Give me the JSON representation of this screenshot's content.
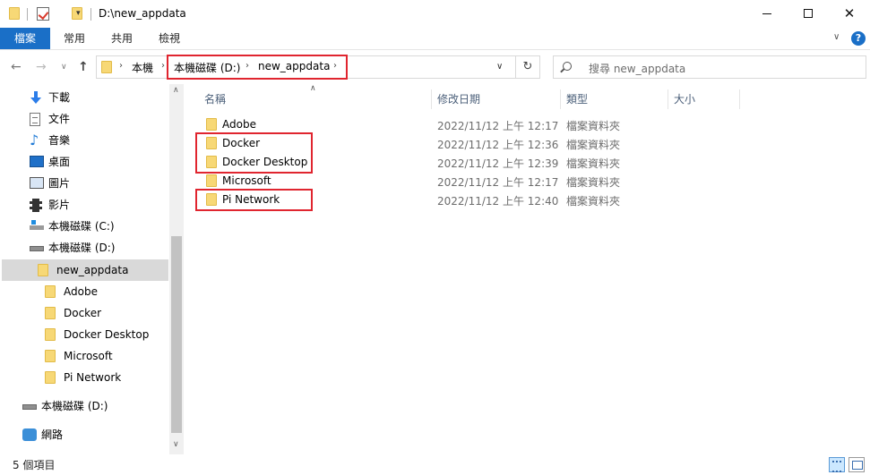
{
  "window": {
    "title": "D:\\new_appdata",
    "minimize_icon": "minimize-icon",
    "maximize_icon": "maximize-icon",
    "close_glyph": "✕"
  },
  "quick_access": {
    "dropdown_glyph": "▾"
  },
  "ribbon": {
    "tabs": [
      "檔案",
      "常用",
      "共用",
      "檢視"
    ],
    "expand_glyph": "∨",
    "help_glyph": "?"
  },
  "nav": {
    "back_glyph": "←",
    "forward_glyph": "→",
    "recent_glyph": "∨",
    "up_glyph": "↑",
    "refresh_glyph": "↻",
    "address": {
      "root": "本機",
      "drive": "本機磁碟 (D:)",
      "folder": "new_appdata",
      "chevron": "›",
      "dropdown_glyph": "∨"
    },
    "search_placeholder": "搜尋 new_appdata"
  },
  "sidebar": {
    "items": [
      {
        "label": "下載",
        "icon": "download-icon"
      },
      {
        "label": "文件",
        "icon": "document-icon"
      },
      {
        "label": "音樂",
        "icon": "music-icon"
      },
      {
        "label": "桌面",
        "icon": "desktop-icon"
      },
      {
        "label": "圖片",
        "icon": "pictures-icon"
      },
      {
        "label": "影片",
        "icon": "videos-icon"
      },
      {
        "label": "本機磁碟 (C:)",
        "icon": "drive-c-icon"
      },
      {
        "label": "本機磁碟 (D:)",
        "icon": "drive-icon"
      },
      {
        "label": "new_appdata",
        "icon": "folder-icon"
      },
      {
        "label": "Adobe",
        "icon": "folder-icon"
      },
      {
        "label": "Docker",
        "icon": "folder-icon"
      },
      {
        "label": "Docker Desktop",
        "icon": "folder-icon"
      },
      {
        "label": "Microsoft",
        "icon": "folder-icon"
      },
      {
        "label": "Pi Network",
        "icon": "folder-icon"
      },
      {
        "label": "本機磁碟 (D:)",
        "icon": "drive-icon"
      },
      {
        "label": "網路",
        "icon": "network-icon"
      }
    ],
    "selected": "new_appdata",
    "scroll_up_glyph": "∧",
    "scroll_down_glyph": "∨"
  },
  "filelist": {
    "sort_glyph": "∧",
    "columns": [
      "名稱",
      "修改日期",
      "類型",
      "大小"
    ],
    "rows": [
      {
        "name": "Adobe",
        "date": "2022/11/12 上午 12:17",
        "type": "檔案資料夾"
      },
      {
        "name": "Docker",
        "date": "2022/11/12 上午 12:36",
        "type": "檔案資料夾"
      },
      {
        "name": "Docker Desktop",
        "date": "2022/11/12 上午 12:39",
        "type": "檔案資料夾"
      },
      {
        "name": "Microsoft",
        "date": "2022/11/12 上午 12:17",
        "type": "檔案資料夾"
      },
      {
        "name": "Pi Network",
        "date": "2022/11/12 上午 12:40",
        "type": "檔案資料夾"
      }
    ]
  },
  "status": {
    "item_count": "5 個項目"
  },
  "colors": {
    "accent": "#1a6fc7",
    "highlight_box": "#e0252f",
    "folder": "#f7d876"
  }
}
